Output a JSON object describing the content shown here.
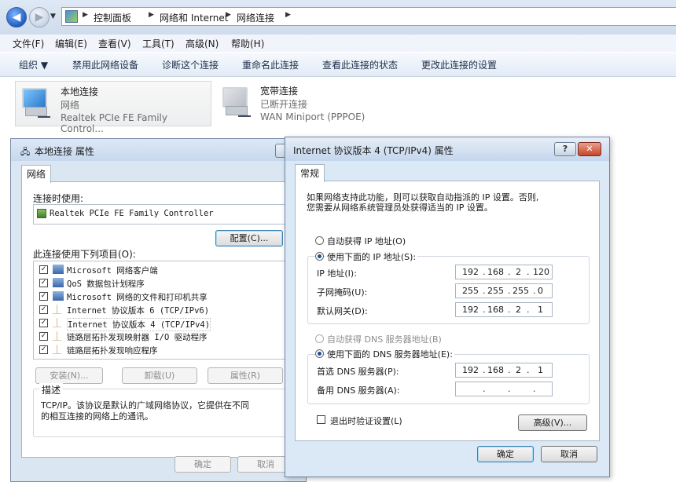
{
  "address": {
    "crumbs": [
      "控制面板",
      "网络和 Internet",
      "网络连接"
    ]
  },
  "menu": [
    "文件(F)",
    "编辑(E)",
    "查看(V)",
    "工具(T)",
    "高级(N)",
    "帮助(H)"
  ],
  "commands": [
    "组织 ▼",
    "禁用此网络设备",
    "诊断这个连接",
    "重命名此连接",
    "查看此连接的状态",
    "更改此连接的设置"
  ],
  "connections": [
    {
      "title": "本地连接",
      "status": "网络",
      "adapter": "Realtek PCIe FE Family Control..."
    },
    {
      "title": "宽带连接",
      "status": "已断开连接",
      "adapter": "WAN Miniport (PPPOE)"
    }
  ],
  "prop1": {
    "title": "本地连接 属性",
    "tab": "网络",
    "connect_using_label": "连接时使用:",
    "adapter_name": "Realtek PCIe FE Family Controller",
    "configure_button": "配置(C)...",
    "items_label": "此连接使用下列项目(O):",
    "items": [
      "Microsoft 网络客户端",
      "QoS 数据包计划程序",
      "Microsoft 网络的文件和打印机共享",
      "Internet 协议版本 6 (TCP/IPv6)",
      "Internet 协议版本 4 (TCP/IPv4)",
      "链路层拓扑发现映射器 I/O 驱动程序",
      "链路层拓扑发现响应程序"
    ],
    "install_button": "安装(N)...",
    "uninstall_button": "卸载(U)",
    "properties_button": "属性(R)",
    "description_label": "描述",
    "description_line1": "TCP/IP。该协议是默认的广域网络协议，它提供在不同",
    "description_line2": "的相互连接的网络上的通讯。",
    "ok_button": "确定",
    "cancel_button": "取消"
  },
  "dlg2": {
    "title": "Internet 协议版本 4 (TCP/IPv4) 属性",
    "help_btn": "?",
    "close_btn": "✕",
    "tab": "常规",
    "intro_line1": "如果网络支持此功能，则可以获取自动指派的 IP 设置。否则,",
    "intro_line2": "您需要从网络系统管理员处获得适当的 IP 设置。",
    "auto_ip": "自动获得 IP 地址(O)",
    "manual_ip": "使用下面的 IP 地址(S):",
    "ip_label": "IP 地址(I):",
    "mask_label": "子网掩码(U):",
    "gateway_label": "默认网关(D):",
    "ip": [
      "192",
      "168",
      "2",
      "120"
    ],
    "mask": [
      "255",
      "255",
      "255",
      "0"
    ],
    "gateway": [
      "192",
      "168",
      "2",
      "1"
    ],
    "auto_dns": "自动获得 DNS 服务器地址(B)",
    "manual_dns": "使用下面的 DNS 服务器地址(E):",
    "pref_dns_label": "首选 DNS 服务器(P):",
    "alt_dns_label": "备用 DNS 服务器(A):",
    "pref_dns": [
      "192",
      "168",
      "2",
      "1"
    ],
    "validate_label": "退出时验证设置(L)",
    "advanced_button": "高级(V)...",
    "ok_button": "确定",
    "cancel_button": "取消"
  }
}
